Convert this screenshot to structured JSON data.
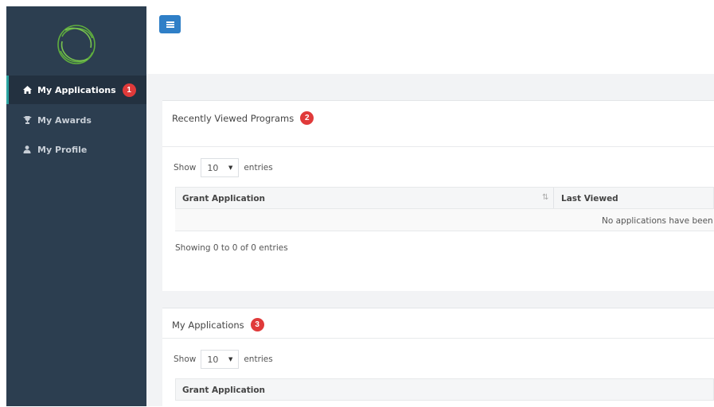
{
  "sidebar": {
    "logo": "circular-ring-logo",
    "items": [
      {
        "label": "My Applications",
        "icon": "home-icon",
        "badge": "1",
        "active": true
      },
      {
        "label": "My Awards",
        "icon": "trophy-icon"
      },
      {
        "label": "My Profile",
        "icon": "user-icon"
      }
    ]
  },
  "header": {
    "menu_icon": "hamburger-icon"
  },
  "recent_panel": {
    "title": "Recently Viewed Programs",
    "badge": "2",
    "show_label": "Show",
    "entries_value": "10",
    "entries_label": "entries",
    "columns": [
      "Grant Application",
      "Last Viewed"
    ],
    "empty_message": "No applications have been re",
    "info": "Showing 0 to 0 of 0 entries"
  },
  "applications_panel": {
    "title": "My Applications",
    "badge": "3",
    "show_label": "Show",
    "entries_value": "10",
    "entries_label": "entries",
    "columns": [
      "Grant Application"
    ]
  },
  "colors": {
    "sidebar_bg": "#2c3e50",
    "accent_button": "#2f7fc7",
    "badge_red": "#e03a3a",
    "active_border": "#2aa3a0"
  }
}
